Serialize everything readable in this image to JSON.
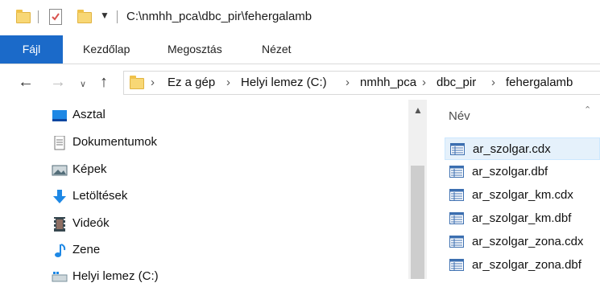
{
  "window": {
    "title_path": "C:\\nmhh_pca\\dbc_pir\\fehergalamb"
  },
  "ribbon": {
    "tabs": [
      {
        "label": "Fájl"
      },
      {
        "label": "Kezdőlap"
      },
      {
        "label": "Megosztás"
      },
      {
        "label": "Nézet"
      }
    ]
  },
  "address": {
    "breadcrumbs": [
      "Ez a gép",
      "Helyi lemez (C:)",
      "nmhh_pca",
      "dbc_pir",
      "fehergalamb"
    ]
  },
  "nav": {
    "items": [
      {
        "label": "Asztal",
        "icon": "desktop-icon"
      },
      {
        "label": "Dokumentumok",
        "icon": "documents-icon"
      },
      {
        "label": "Képek",
        "icon": "pictures-icon"
      },
      {
        "label": "Letöltések",
        "icon": "downloads-icon"
      },
      {
        "label": "Videók",
        "icon": "videos-icon"
      },
      {
        "label": "Zene",
        "icon": "music-icon"
      },
      {
        "label": "Helyi lemez (C:)",
        "icon": "drive-icon"
      }
    ]
  },
  "files": {
    "column_header": "Név",
    "items": [
      {
        "name": "ar_szolgar.cdx",
        "selected": true
      },
      {
        "name": "ar_szolgar.dbf",
        "selected": false
      },
      {
        "name": "ar_szolgar_km.cdx",
        "selected": false
      },
      {
        "name": "ar_szolgar_km.dbf",
        "selected": false
      },
      {
        "name": "ar_szolgar_zona.cdx",
        "selected": false
      },
      {
        "name": "ar_szolgar_zona.dbf",
        "selected": false
      }
    ]
  },
  "colors": {
    "file_tab": "#1b6ac9",
    "selection": "#e5f1fb"
  }
}
